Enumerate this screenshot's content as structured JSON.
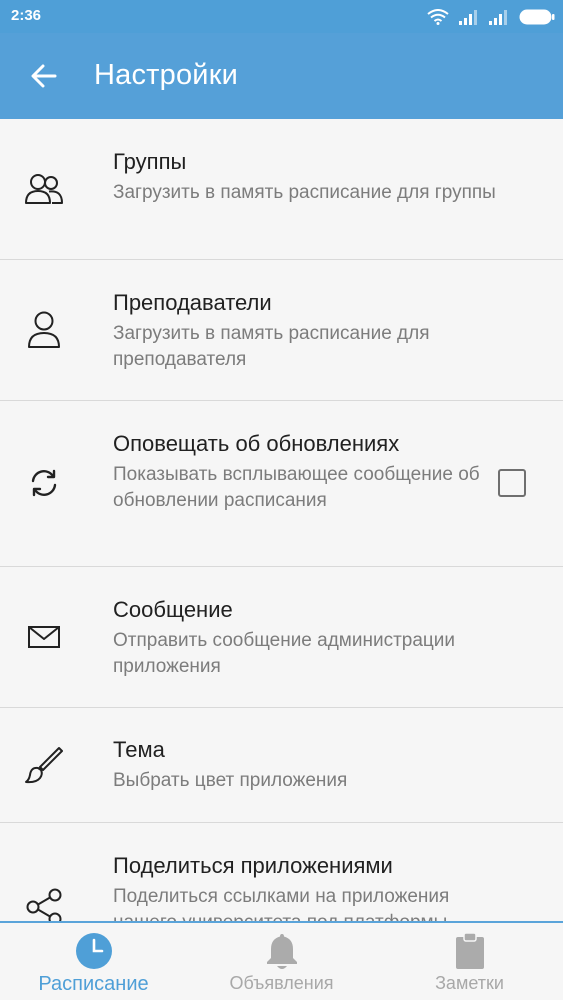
{
  "status_bar": {
    "time": "2:36"
  },
  "app_bar": {
    "title": "Настройки",
    "back_icon": "arrow-left-icon"
  },
  "settings": [
    {
      "icon": "users-icon",
      "title": "Группы",
      "description": "Загрузить в память расписание для группы"
    },
    {
      "icon": "user-icon",
      "title": "Преподаватели",
      "description": "Загрузить в память расписание для преподавателя"
    },
    {
      "icon": "sync-icon",
      "title": "Оповещать об обновлениях",
      "description": "Показывать всплывающее сообщение об обновлении расписания",
      "checked": false
    },
    {
      "icon": "mail-icon",
      "title": "Сообщение",
      "description": "Отправить сообщение администрации приложения"
    },
    {
      "icon": "brush-icon",
      "title": "Тема",
      "description": "Выбрать цвет приложения"
    },
    {
      "icon": "share-icon",
      "title": "Поделиться приложениями",
      "description": "Поделиться ссылками на приложения нашего университета под платформы"
    }
  ],
  "bottom_nav": [
    {
      "label": "Расписание",
      "icon": "clock-icon",
      "active": true
    },
    {
      "label": "Объявления",
      "icon": "bell-icon",
      "active": false
    },
    {
      "label": "Заметки",
      "icon": "clipboard-icon",
      "active": false
    }
  ],
  "colors": {
    "primary": "#55a0d8",
    "active_tab": "#4f9fd7",
    "inactive_tab": "#a8a8a8"
  }
}
